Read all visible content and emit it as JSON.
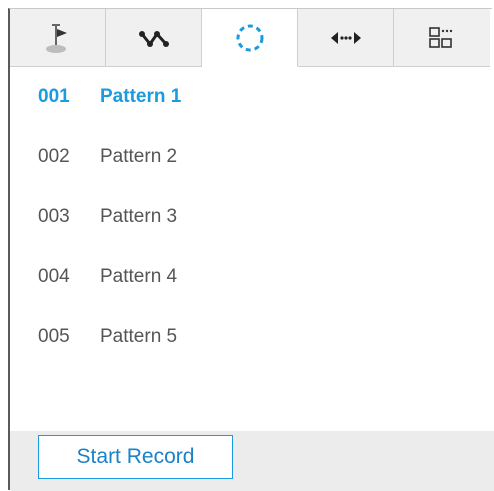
{
  "tabs": [
    {
      "icon": "preset-flag-icon",
      "active": false
    },
    {
      "icon": "tour-path-icon",
      "active": false
    },
    {
      "icon": "pattern-circle-icon",
      "active": true
    },
    {
      "icon": "scan-arrows-icon",
      "active": false
    },
    {
      "icon": "grid-layout-icon",
      "active": false
    }
  ],
  "patterns": [
    {
      "num": "001",
      "name": "Pattern 1",
      "selected": true
    },
    {
      "num": "002",
      "name": "Pattern 2",
      "selected": false
    },
    {
      "num": "003",
      "name": "Pattern 3",
      "selected": false
    },
    {
      "num": "004",
      "name": "Pattern 4",
      "selected": false
    },
    {
      "num": "005",
      "name": "Pattern 5",
      "selected": false
    }
  ],
  "footer": {
    "start_record_label": "Start Record"
  },
  "colors": {
    "accent": "#1a9be0",
    "text": "#555555",
    "tab_bg": "#f0f0f0",
    "footer_bg": "#ececec"
  }
}
